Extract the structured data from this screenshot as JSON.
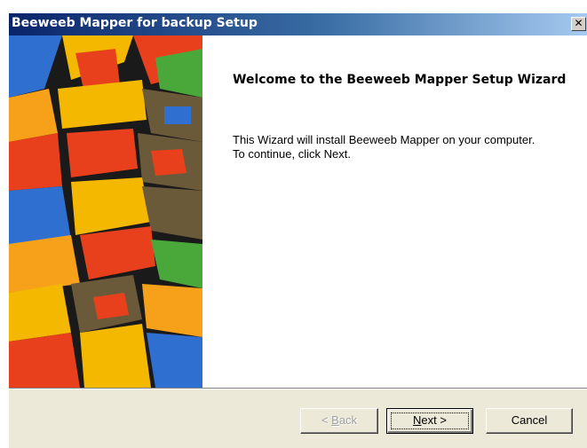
{
  "window": {
    "title": "Beeweeb Mapper for backup Setup",
    "close_label": "✕"
  },
  "content": {
    "heading": "Welcome to the Beeweeb Mapper Setup Wizard",
    "line1": "This Wizard will install Beeweeb Mapper on your computer.",
    "line2": "To continue, click Next."
  },
  "buttons": {
    "back": {
      "prefix": "< ",
      "mnemonic": "B",
      "rest": "ack",
      "enabled": false
    },
    "next": {
      "mnemonic": "N",
      "rest": "ext >",
      "enabled": true
    },
    "cancel": {
      "label": "Cancel",
      "enabled": true
    }
  },
  "colors": {
    "title_start": "#0a246a",
    "title_end": "#a6caf0",
    "footer_bg": "#ece9d8"
  }
}
